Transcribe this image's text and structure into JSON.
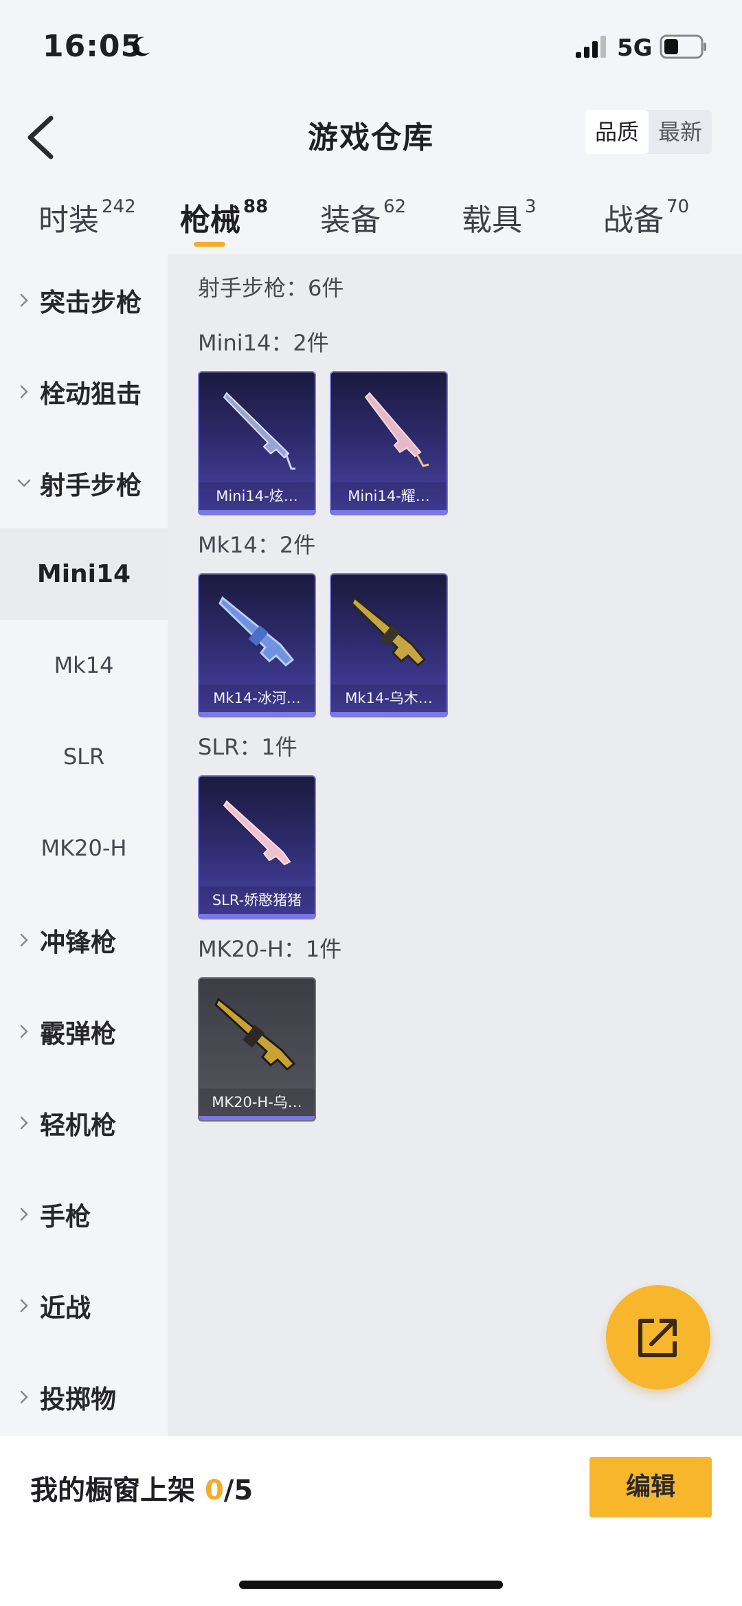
{
  "status_bar": {
    "time": "16:05",
    "network": "5G",
    "icons": [
      "moon-icon",
      "signal-icon",
      "battery-icon"
    ]
  },
  "header": {
    "title": "游戏仓库",
    "back_icon": "chevron-left-icon"
  },
  "sort": {
    "options": [
      "品质",
      "最新"
    ],
    "selected": "品质"
  },
  "tabs": [
    {
      "label": "时装",
      "count": "242"
    },
    {
      "label": "枪械",
      "count": "88"
    },
    {
      "label": "装备",
      "count": "62"
    },
    {
      "label": "载具",
      "count": "3"
    },
    {
      "label": "战备",
      "count": "70"
    }
  ],
  "active_tab": "枪械",
  "sidebar": {
    "items": [
      {
        "label": "突击步枪"
      },
      {
        "label": "栓动狙击"
      },
      {
        "label": "射手步枪"
      },
      {
        "label": "冲锋枪"
      },
      {
        "label": "霰弹枪"
      },
      {
        "label": "轻机枪"
      },
      {
        "label": "手枪"
      },
      {
        "label": "近战"
      },
      {
        "label": "投掷物"
      }
    ],
    "sub_items": [
      "Mini14",
      "Mk14",
      "SLR",
      "MK20-H"
    ],
    "active_sub": "Mini14"
  },
  "content": {
    "section_title": "射手步枪：6件",
    "groups": [
      {
        "title": "Mini14：2件",
        "items": [
          "Mini14-炫…",
          "Mini14-耀…"
        ]
      },
      {
        "title": "Mk14：2件",
        "items": [
          "Mk14-冰河…",
          "Mk14-乌木…"
        ]
      },
      {
        "title": "SLR：1件",
        "items": [
          "SLR-娇憨猪猪"
        ]
      },
      {
        "title": "MK20-H：1件",
        "items": [
          "MK20-H-乌…"
        ]
      }
    ]
  },
  "fab": {
    "icon": "share-icon"
  },
  "bottom_bar": {
    "label": "我的橱窗上架 ",
    "count_current": "0",
    "count_total": "/5",
    "edit_label": "编辑"
  },
  "colors": {
    "accent": "#f7b62c",
    "card_purple": "#4a44a8",
    "card_grey": "#55565e"
  }
}
